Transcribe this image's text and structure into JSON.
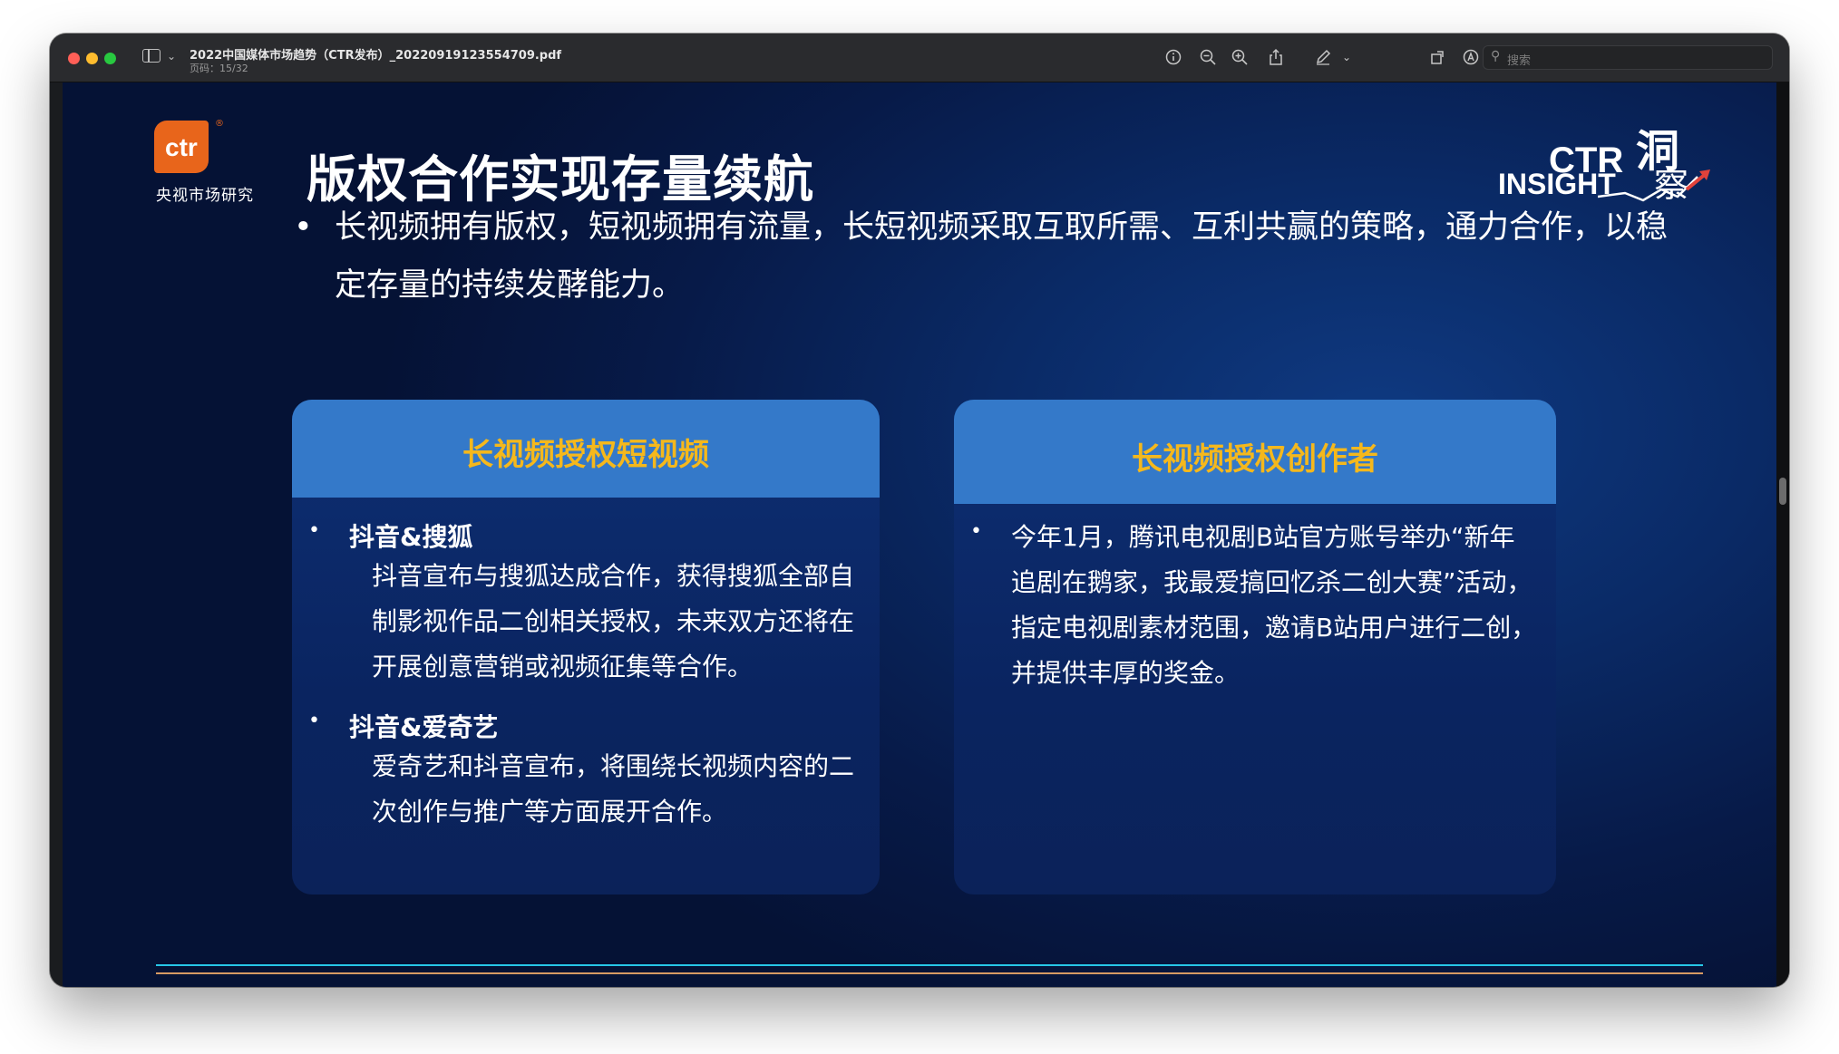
{
  "window": {
    "doc_title": "2022中国媒体市场趋势（CTR发布）_20220919123554709.pdf",
    "page_indicator": "页码：15/32",
    "search_placeholder": "搜索"
  },
  "slide": {
    "logo_text": "ctr",
    "logo_registered": "®",
    "logo_cn": "央视市场研究",
    "title": "版权合作实现存量续航",
    "insight_ctr": "CTR",
    "insight_insight": "INSIGHT",
    "insight_dong": "洞",
    "insight_cha": "察",
    "main_bullet": "长视频拥有版权，短视频拥有流量，长短视频采取互取所需、互利共赢的策略，通力合作，以稳定存量的持续发酵能力。",
    "bullet_char": "•",
    "card_left": {
      "title": "长视频授权短视频",
      "items": [
        {
          "label": "抖音&搜狐",
          "body": "抖音宣布与搜狐达成合作，获得搜狐全部自制影视作品二创相关授权，未来双方还将在开展创意营销或视频征集等合作。"
        },
        {
          "label": "抖音&爱奇艺",
          "body": "爱奇艺和抖音宣布，将围绕长视频内容的二次创作与推广等方面展开合作。"
        }
      ]
    },
    "card_right": {
      "title": "长视频授权创作者",
      "items": [
        {
          "body": "今年1月，腾讯电视剧B站官方账号举办“新年追剧在鹅家，我最爱搞回忆杀二创大赛”活动，指定电视剧素材范围，邀请B站用户进行二创，并提供丰厚的奖金。"
        }
      ]
    }
  },
  "colors": {
    "accent_orange": "#e8651b",
    "card_title_yellow": "#f5b81c",
    "card_header_blue": "#3479c9",
    "line_cyan": "#27c7e8",
    "line_orange": "#d79a63"
  }
}
